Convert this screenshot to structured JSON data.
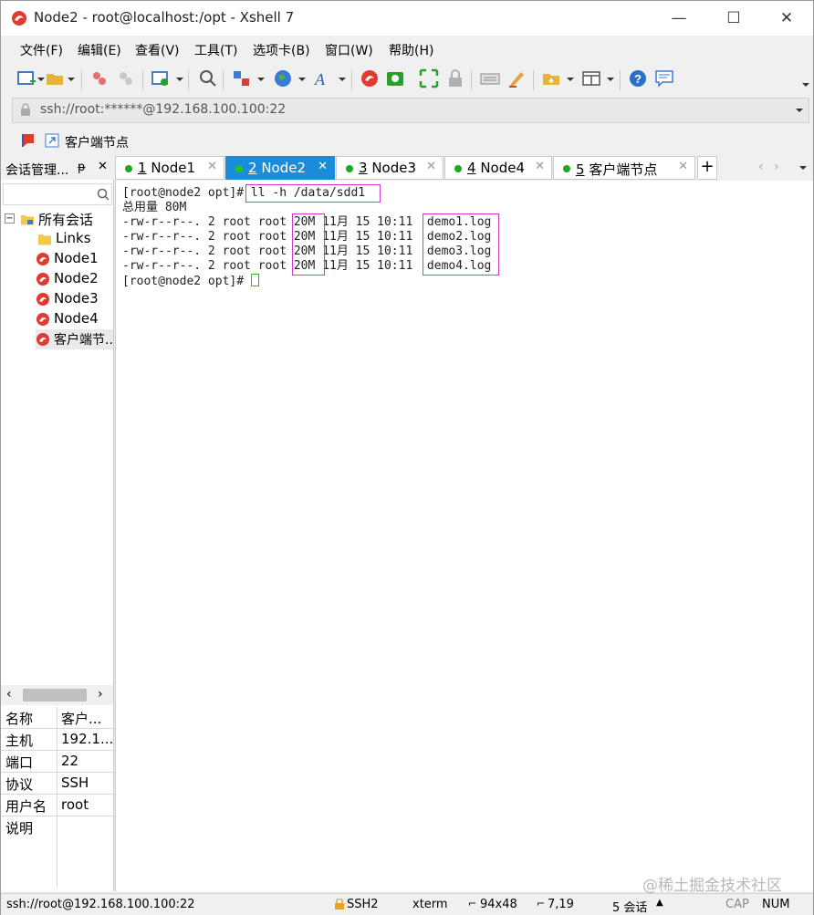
{
  "window": {
    "title": "Node2 - root@localhost:/opt - Xshell 7",
    "minimize": "—",
    "maximize": "☐",
    "close": "✕"
  },
  "menu": [
    "文件(F)",
    "编辑(E)",
    "查看(V)",
    "工具(T)",
    "选项卡(B)",
    "窗口(W)",
    "帮助(H)"
  ],
  "address": {
    "url": "ssh://root:******@192.168.100.100:22"
  },
  "links": {
    "label": "客户端节点"
  },
  "sidepanel": {
    "title": "会话管理...",
    "pin": "ᵽ",
    "close": "✕",
    "tree": {
      "root": "所有会话",
      "items": [
        "Links",
        "Node1",
        "Node2",
        "Node3",
        "Node4",
        "客户端节..."
      ]
    },
    "props": [
      {
        "k": "名称",
        "v": "客户..."
      },
      {
        "k": "主机",
        "v": "192.1..."
      },
      {
        "k": "端口",
        "v": "22"
      },
      {
        "k": "协议",
        "v": "SSH"
      },
      {
        "k": "用户名",
        "v": "root"
      },
      {
        "k": "说明",
        "v": ""
      }
    ]
  },
  "tabs": [
    {
      "num": "1",
      "name": "Node1"
    },
    {
      "num": "2",
      "name": "Node2"
    },
    {
      "num": "3",
      "name": "Node3"
    },
    {
      "num": "4",
      "name": "Node4"
    },
    {
      "num": "5",
      "name": "客户端节点"
    }
  ],
  "tab_add": "+",
  "terminal": {
    "prompt1": "[root@node2 opt]# ",
    "command": "ll -h /data/sdd1",
    "total": "总用量 80M",
    "files": [
      {
        "perm": "-rw-r--r--.",
        "links": "2",
        "user": "root",
        "group": "root",
        "size": "20M",
        "date": "11月 15 10:11",
        "name": "demo1.log"
      },
      {
        "perm": "-rw-r--r--.",
        "links": "2",
        "user": "root",
        "group": "root",
        "size": "20M",
        "date": "11月 15 10:11",
        "name": "demo2.log"
      },
      {
        "perm": "-rw-r--r--.",
        "links": "2",
        "user": "root",
        "group": "root",
        "size": "20M",
        "date": "11月 15 10:11",
        "name": "demo3.log"
      },
      {
        "perm": "-rw-r--r--.",
        "links": "2",
        "user": "root",
        "group": "root",
        "size": "20M",
        "date": "11月 15 10:11",
        "name": "demo4.log"
      }
    ],
    "prompt2": "[root@node2 opt]# "
  },
  "status": {
    "conn": "ssh://root@192.168.100.100:22",
    "proto": "SSH2",
    "term": "xterm",
    "size": "94x48",
    "pos": "7,19",
    "sessions": "5 会话",
    "cap": "CAP",
    "num": "NUM"
  },
  "watermark": "@稀土掘金技术社区",
  "colors": {
    "accent": "#1a8cd8",
    "highlight": "#d039c8",
    "online": "#1aaa1a"
  }
}
